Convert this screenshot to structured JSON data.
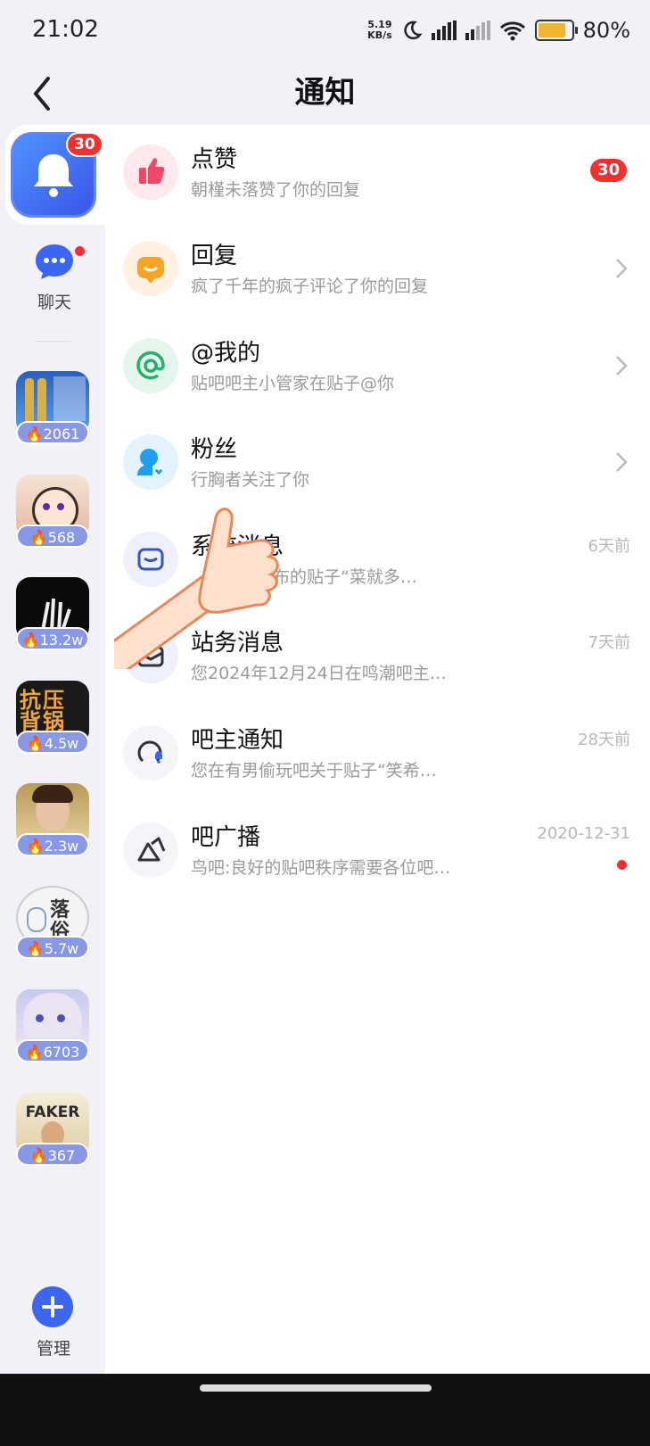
{
  "status": {
    "time": "21:02",
    "net_speed_top": "5.19",
    "net_speed_unit": "KB/s",
    "battery": "80%",
    "battery_level": 0.8
  },
  "header": {
    "title": "通知"
  },
  "rail": {
    "bell_badge": "30",
    "chat_label": "聊天",
    "forums": [
      {
        "heat": "2061"
      },
      {
        "heat": "568"
      },
      {
        "heat": "13.2w"
      },
      {
        "heat": "4.5w"
      },
      {
        "heat": "2.3w"
      },
      {
        "heat": "5.7w"
      },
      {
        "heat": "6703"
      },
      {
        "heat": "367"
      }
    ],
    "forum_texts": {
      "f4_text": "抗压 背锅",
      "f6_text": "落俗",
      "f8_text": "FAKER"
    },
    "manage_label": "管理"
  },
  "notifications": [
    {
      "name": "点赞",
      "desc": "朝槿未落赞了你的回复",
      "count": "30"
    },
    {
      "name": "回复",
      "desc": "疯了千年的疯子评论了你的回复"
    },
    {
      "name": "@我的",
      "desc": "贴吧吧主小管家在贴子@你"
    },
    {
      "name": "粉丝",
      "desc": "行胸者关注了你"
    },
    {
      "name": "系统消息",
      "desc": "吧发布的贴子“菜就多…",
      "time": "6天前"
    },
    {
      "name": "站务消息",
      "desc": "您2024年12月24日在鸣潮吧主…",
      "time": "7天前"
    },
    {
      "name": "吧主通知",
      "desc": "您在有男偷玩吧关于贴子“笑希…",
      "time": "28天前"
    },
    {
      "name": "吧广播",
      "desc": "鸟吧:良好的贴吧秩序需要各位吧…",
      "time": "2020-12-31"
    }
  ],
  "colors": {
    "accent": "#3c66f0",
    "badge": "#f1302f",
    "rail_bg": "#f3f1f8"
  }
}
